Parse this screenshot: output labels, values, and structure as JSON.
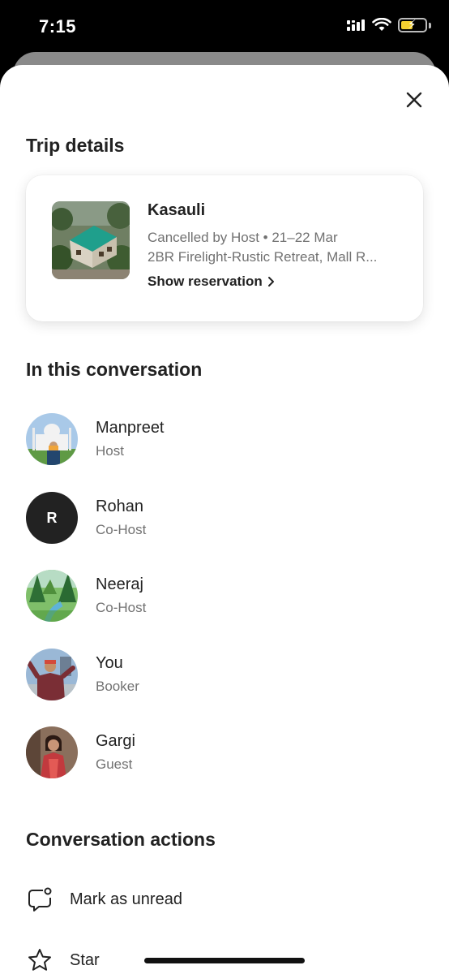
{
  "status_bar": {
    "time": "7:15"
  },
  "sheet": {
    "trip_details_title": "Trip details",
    "trip": {
      "city": "Kasauli",
      "status_dates": "Cancelled by Host • 21–22 Mar",
      "listing": "2BR Firelight-Rustic Retreat, Mall R...",
      "show_reservation": "Show reservation"
    },
    "conversation_title": "In this conversation",
    "participants": [
      {
        "name": "Manpreet",
        "role": "Host"
      },
      {
        "name": "Rohan",
        "role": "Co-Host",
        "initial": "R"
      },
      {
        "name": "Neeraj",
        "role": "Co-Host"
      },
      {
        "name": "You",
        "role": "Booker"
      },
      {
        "name": "Gargi",
        "role": "Guest"
      }
    ],
    "actions_title": "Conversation actions",
    "actions": [
      {
        "label": "Mark as unread",
        "icon": "chat-unread-icon"
      },
      {
        "label": "Star",
        "icon": "star-icon"
      }
    ]
  },
  "colors": {
    "text": "#222222",
    "secondary": "#717171",
    "battery": "#f5d130"
  }
}
